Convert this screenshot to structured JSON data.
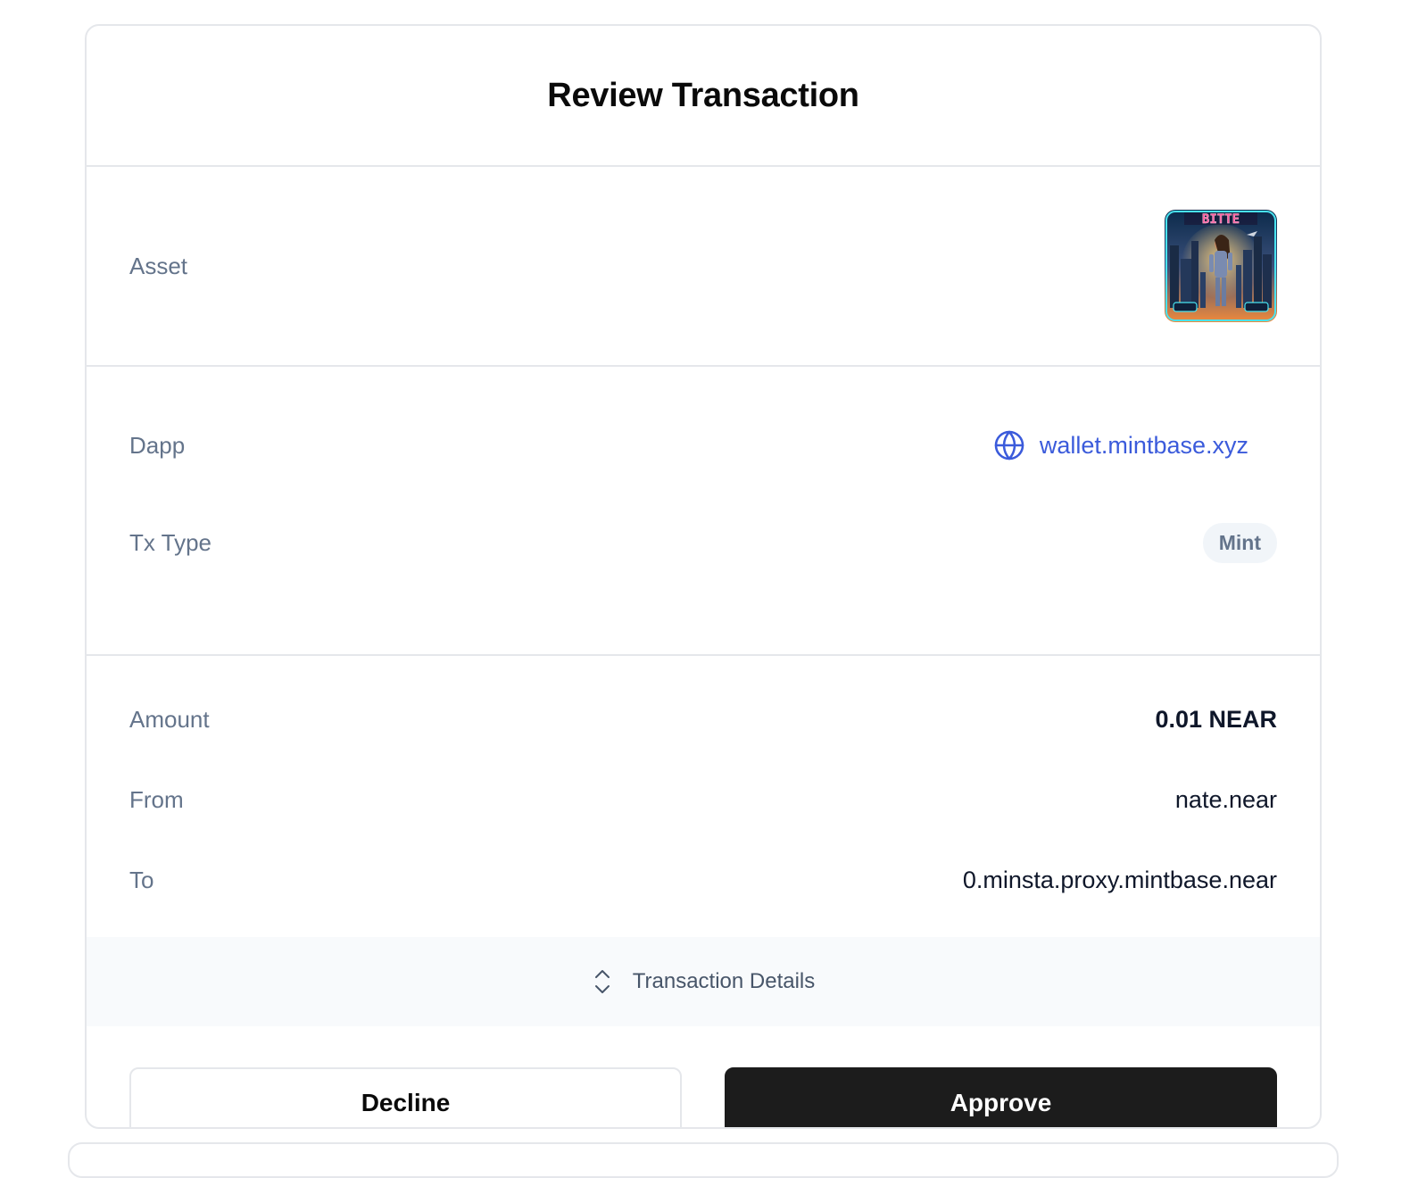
{
  "dialog": {
    "title": "Review Transaction"
  },
  "asset": {
    "label": "Asset",
    "image_caption": "BITTE"
  },
  "dapp": {
    "label": "Dapp",
    "value": "wallet.mintbase.xyz",
    "icon": "globe-icon",
    "link_color": "#3b5bdb"
  },
  "tx_type": {
    "label": "Tx Type",
    "value": "Mint"
  },
  "amount": {
    "label": "Amount",
    "value": "0.01 NEAR"
  },
  "from": {
    "label": "From",
    "value": "nate.near"
  },
  "to": {
    "label": "To",
    "value": "0.minsta.proxy.mintbase.near"
  },
  "details": {
    "label": "Transaction Details",
    "icon": "chevrons-up-down-icon"
  },
  "actions": {
    "decline_label": "Decline",
    "approve_label": "Approve",
    "approve_color": "#1c1c1c"
  }
}
